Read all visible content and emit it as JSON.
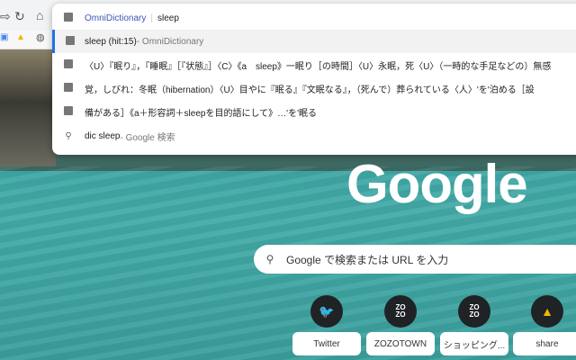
{
  "omnibox": {
    "keyword": "OmniDictionary",
    "query": "sleep"
  },
  "suggestions": [
    {
      "icon": "dictionary-icon",
      "text": "sleep (hit:15)",
      "suffix": " - OmniDictionary"
    },
    {
      "icon": "dictionary-icon",
      "text": "〈U〉『眠り』，『睡眠』［『状態』］〈C〉《a　sleep》一眠り［の時間］〈U〉永眠，死〈U〉（一時的な手足などの）無感"
    },
    {
      "icon": "dictionary-icon",
      "text": "覚，しびれ：冬眠（hibernation）〈U〉目やに『眠る』『文眠なる』，（死んで）葬られている〈人〉'を'泊める［設"
    },
    {
      "icon": "dictionary-icon",
      "text": "備がある］《a＋形容詞＋sleepを目的語にして》…'を'眠る"
    },
    {
      "icon": "search-icon",
      "text": "dic sleep",
      "suffix": " - Google 検索"
    }
  ],
  "ntp": {
    "logo": "Google",
    "search_placeholder": "Google で検索または URL を入力",
    "shortcuts": [
      {
        "label": "Twitter",
        "icon": "twitter-icon"
      },
      {
        "label": "ZOZOTOWN",
        "icon": "zozo-icon"
      },
      {
        "label": "ショッピング...",
        "icon": "zozo-icon"
      },
      {
        "label": "share",
        "icon": "google-drive-icon"
      }
    ]
  }
}
